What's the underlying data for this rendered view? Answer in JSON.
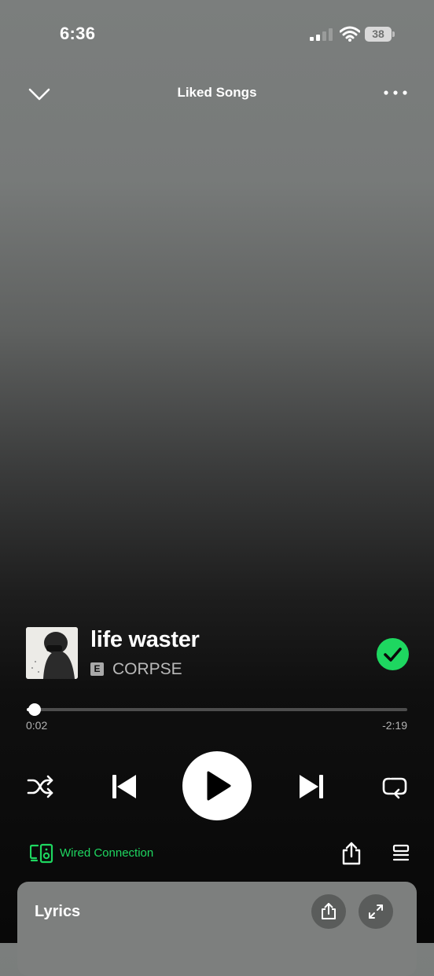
{
  "status_bar": {
    "time": "6:36",
    "battery": "38",
    "icons": [
      "signal-icon",
      "wifi-icon",
      "battery-icon"
    ]
  },
  "header": {
    "title": "Liked Songs",
    "left_icon": "chevron-down-icon",
    "right_icon": "more-icon"
  },
  "track": {
    "title": "life waster",
    "explicit_badge": "E",
    "artist": "CORPSE",
    "liked": true,
    "elapsed": "0:02",
    "remaining": "-2:19",
    "progress_fraction": 0.014
  },
  "controls": {
    "icons": [
      "shuffle-icon",
      "previous-icon",
      "play-icon",
      "next-icon",
      "repeat-icon"
    ]
  },
  "bottom_bar": {
    "device_label": "Wired Connection",
    "icons": [
      "speaker-device-icon",
      "share-icon",
      "queue-icon"
    ]
  },
  "lyrics_card": {
    "title": "Lyrics",
    "icons": [
      "share-icon",
      "expand-icon"
    ]
  },
  "colors": {
    "accent": "#1ed760",
    "card": "#7d7f7e"
  }
}
